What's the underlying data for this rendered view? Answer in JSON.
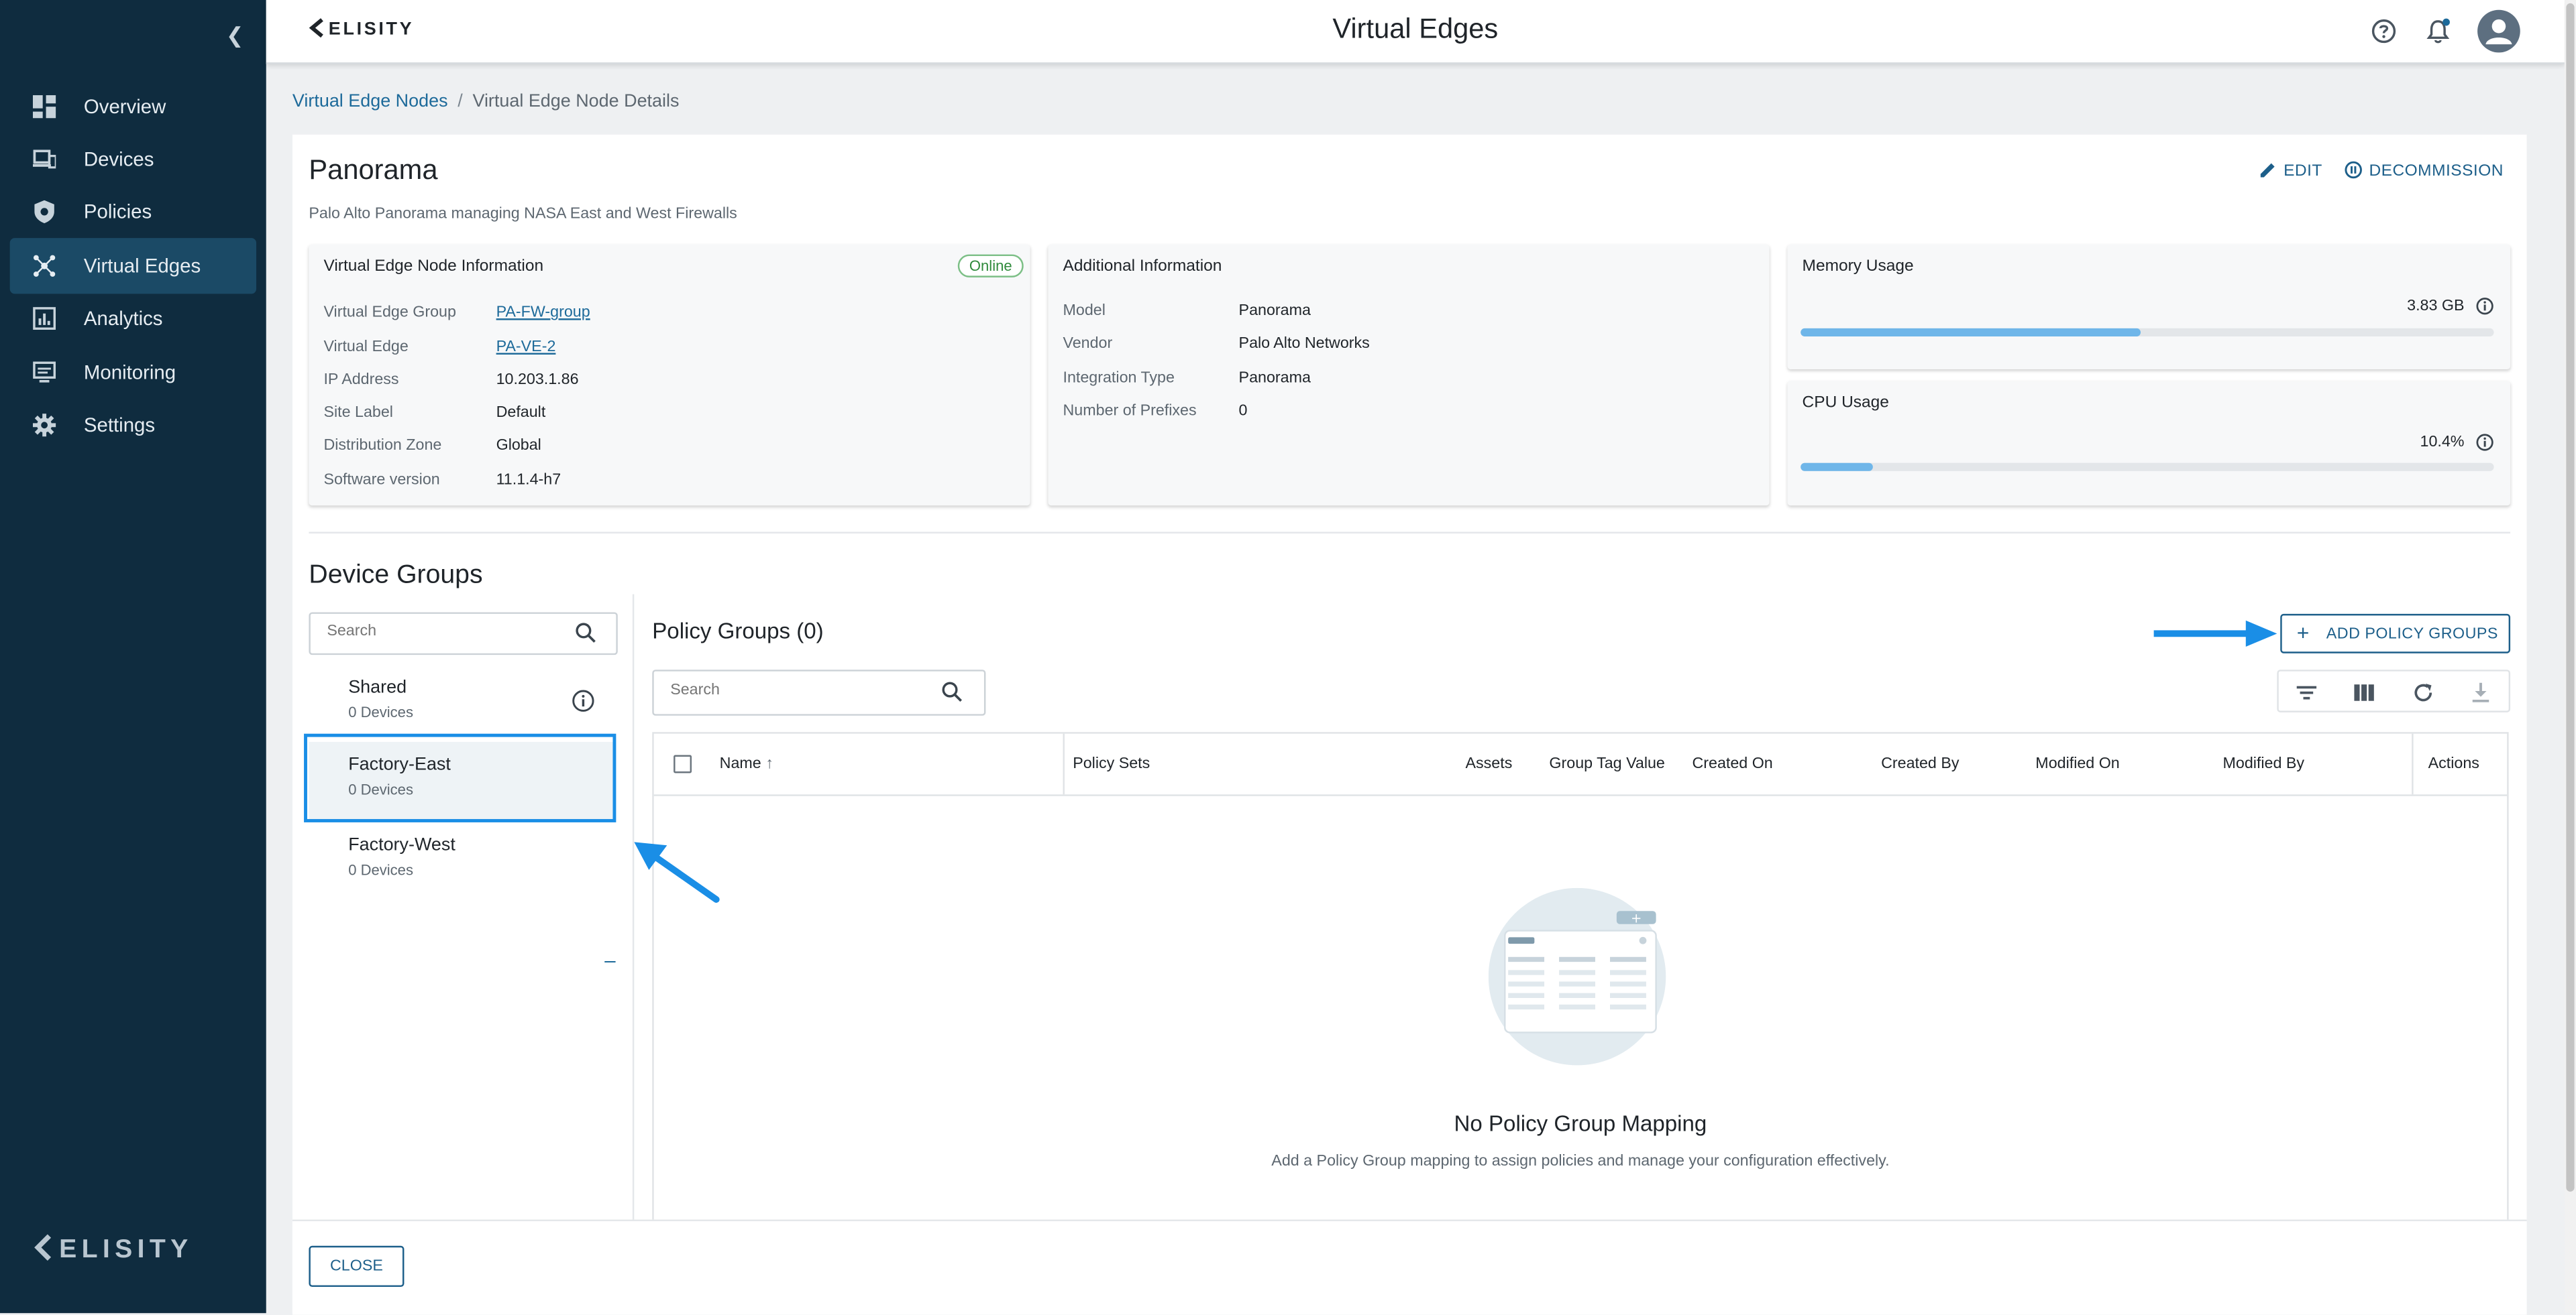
{
  "sidebar": {
    "items": [
      {
        "label": "Overview",
        "icon": "dashboard-icon"
      },
      {
        "label": "Devices",
        "icon": "devices-icon"
      },
      {
        "label": "Policies",
        "icon": "shield-icon"
      },
      {
        "label": "Virtual Edges",
        "icon": "network-icon"
      },
      {
        "label": "Analytics",
        "icon": "analytics-icon"
      },
      {
        "label": "Monitoring",
        "icon": "monitor-icon"
      },
      {
        "label": "Settings",
        "icon": "gear-icon"
      }
    ],
    "active": "Virtual Edges",
    "logo": "ELISITY"
  },
  "header": {
    "logo": "ELISITY",
    "title": "Virtual Edges"
  },
  "breadcrumb": {
    "parent": "Virtual Edge Nodes",
    "separator": "/",
    "current": "Virtual Edge Node Details"
  },
  "node": {
    "name": "Panorama",
    "description": "Palo Alto Panorama managing NASA East and West Firewalls",
    "edit_label": "EDIT",
    "decommission_label": "DECOMMISSION"
  },
  "info_panel": {
    "title": "Virtual Edge Node Information",
    "status": "Online",
    "rows": [
      {
        "key": "Virtual Edge Group",
        "value": "PA-FW-group"
      },
      {
        "key": "Virtual Edge",
        "value": "PA-VE-2"
      },
      {
        "key": "IP Address",
        "value": "10.203.1.86"
      },
      {
        "key": "Site Label",
        "value": "Default"
      },
      {
        "key": "Distribution Zone",
        "value": "Global"
      },
      {
        "key": "Software version",
        "value": "11.1.4-h7"
      }
    ]
  },
  "additional_panel": {
    "title": "Additional Information",
    "rows": [
      {
        "key": "Model",
        "value": "Panorama"
      },
      {
        "key": "Vendor",
        "value": "Palo Alto Networks"
      },
      {
        "key": "Integration Type",
        "value": "Panorama"
      },
      {
        "key": "Number of Prefixes",
        "value": "0"
      }
    ]
  },
  "memory": {
    "title": "Memory Usage",
    "value": "3.83 GB",
    "fill_fraction": 0.49
  },
  "cpu": {
    "title": "CPU Usage",
    "value": "10.4%",
    "fill_fraction": 0.104
  },
  "device_groups": {
    "title": "Device Groups",
    "search_placeholder": "Search",
    "items": [
      {
        "name": "Shared",
        "count": "0 Devices"
      },
      {
        "name": "Factory-East",
        "count": "0 Devices"
      },
      {
        "name": "Factory-West",
        "count": "0 Devices"
      }
    ],
    "selected": "Factory-East",
    "collapse_symbol": "–"
  },
  "policy_groups": {
    "title": "Policy Groups (0)",
    "add_label": "ADD POLICY GROUPS",
    "search_placeholder": "Search",
    "columns": [
      "Name",
      "Policy Sets",
      "Assets",
      "Group Tag Value",
      "Created On",
      "Created By",
      "Modified On",
      "Modified By",
      "Actions"
    ],
    "empty_title": "No Policy Group Mapping",
    "empty_desc": "Add a Policy Group mapping to assign policies and manage your configuration effectively."
  },
  "footer": {
    "close_label": "CLOSE"
  },
  "colors": {
    "sidebar": "#0f2c3f",
    "active_nav": "#1b4a66",
    "accent": "#1d5f8a",
    "annotation": "#1a8ee6"
  }
}
